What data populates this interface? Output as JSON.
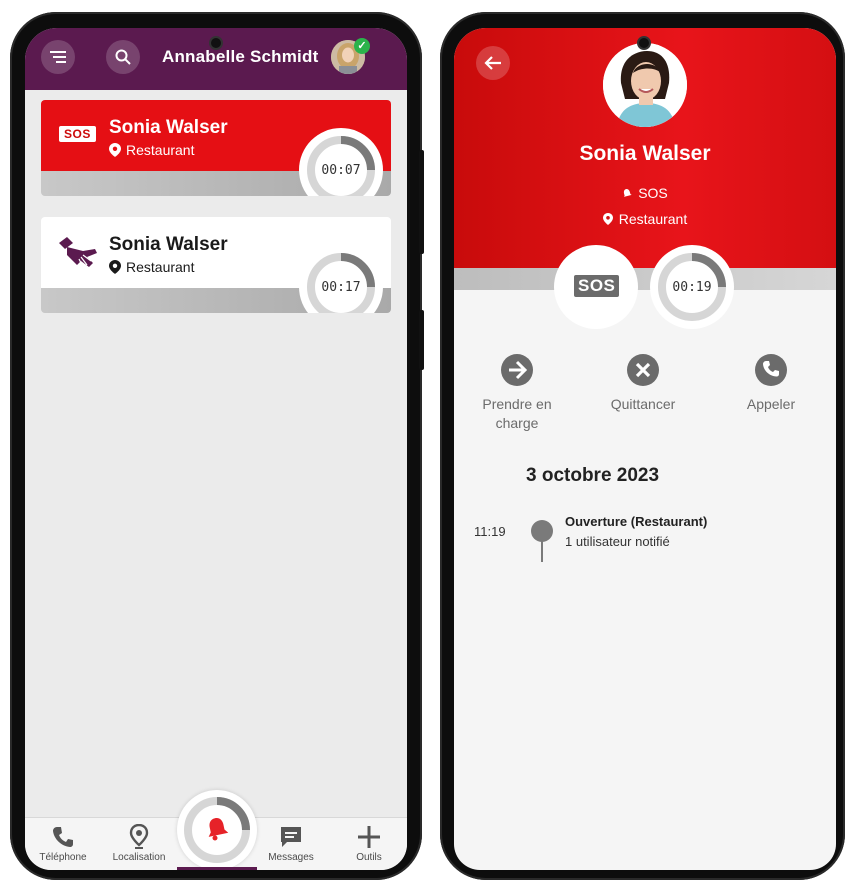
{
  "left": {
    "header": {
      "user_name": "Annabelle Schmidt"
    },
    "alerts": [
      {
        "type": "SOS",
        "badge": "SOS",
        "name": "Sonia Walser",
        "location": "Restaurant",
        "timer": "00:07",
        "progress": 0.25,
        "accent": "#e50f14"
      },
      {
        "type": "hand",
        "badge": "",
        "name": "Sonia Walser",
        "location": "Restaurant",
        "timer": "00:17",
        "progress": 0.25,
        "accent": "#5b1a4f"
      }
    ],
    "nav": [
      {
        "label": "Téléphone",
        "icon": "phone-icon"
      },
      {
        "label": "Localisation",
        "icon": "location-icon"
      },
      {
        "label": "",
        "icon": "bell-icon"
      },
      {
        "label": "Messages",
        "icon": "message-icon"
      },
      {
        "label": "Outils",
        "icon": "plus-icon"
      }
    ]
  },
  "right": {
    "name": "Sonia Walser",
    "alert_type": "SOS",
    "location": "Restaurant",
    "badge": "SOS",
    "timer": "00:19",
    "timer_progress": 0.25,
    "actions": [
      {
        "label": "Prendre en charge",
        "icon": "arrow-right-icon"
      },
      {
        "label": "Quittancer",
        "icon": "close-circle-icon"
      },
      {
        "label": "Appeler",
        "icon": "phone-icon"
      }
    ],
    "timeline": {
      "date": "3 octobre 2023",
      "events": [
        {
          "time": "11:19",
          "title": "Ouverture (Restaurant)",
          "subtitle": "1 utilisateur notifié"
        }
      ]
    }
  },
  "colors": {
    "header_purple": "#5b1a4f",
    "alert_red": "#e50f14",
    "bell_red": "#e62228"
  }
}
